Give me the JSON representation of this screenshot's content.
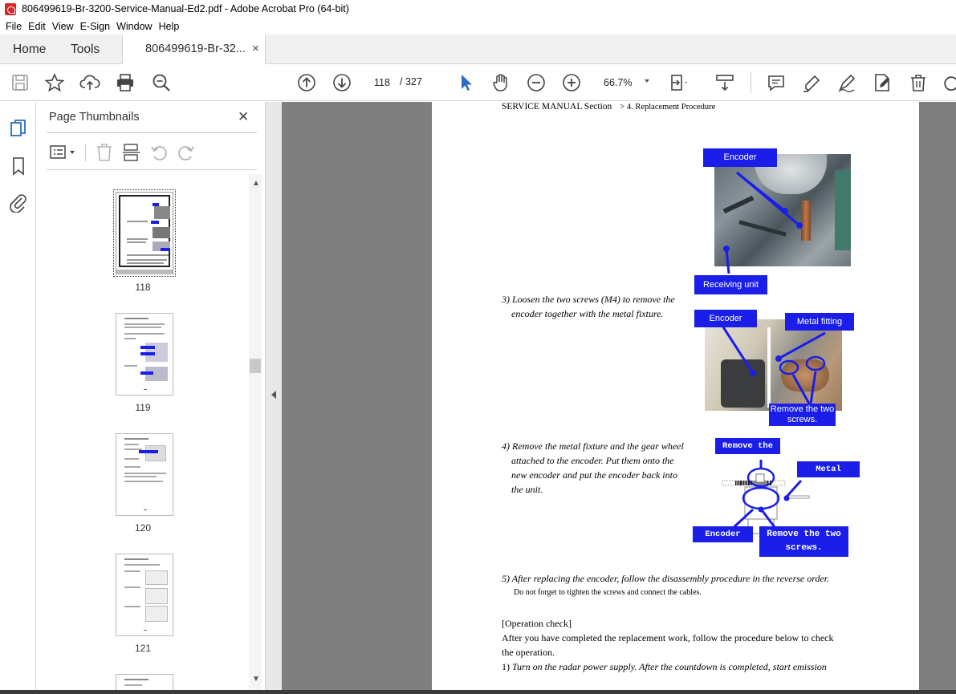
{
  "window": {
    "title": "806499619-Br-3200-Service-Manual-Ed2.pdf - Adobe Acrobat Pro (64-bit)"
  },
  "menu": [
    "File",
    "Edit",
    "View",
    "E-Sign",
    "Window",
    "Help"
  ],
  "tabs": {
    "home": "Home",
    "tools": "Tools",
    "document": "806499619-Br-32...",
    "close": "×"
  },
  "toolbar": {
    "page_current": "118",
    "page_total": "/ 327",
    "zoom": "66.7%",
    "icons": [
      "save-icon",
      "bookmark-star-icon",
      "upload-icon",
      "print-icon",
      "search-zoom-icon",
      "page-up-icon",
      "page-down-icon",
      "select-cursor-icon",
      "hand-icon",
      "zoom-out-icon",
      "zoom-in-icon",
      "fit-page-icon",
      "scroll-mode-icon",
      "comment-icon",
      "highlight-pen-icon",
      "sign-icon",
      "edit-icon",
      "delete-icon",
      "rotate-icon"
    ]
  },
  "thumbnails_panel": {
    "title": "Page Thumbnails",
    "close": "✕",
    "pages": [
      "118",
      "119",
      "120",
      "121"
    ]
  },
  "document": {
    "header": "SERVICE MANUAL Section",
    "header_sub": "> 4. Replacement Procedure",
    "labels": {
      "encoder1": "Encoder",
      "receiving_unit": "Receiving unit",
      "encoder2": "Encoder",
      "metal_fitting": "Metal fitting",
      "remove_two_screws_a": "Remove the two",
      "remove_two_screws_b": "screws.",
      "remove_nut": "Remove the nut",
      "metal_fitting2": "Metal fitting",
      "encoder3": "Encoder",
      "remove_two_screws2_a": "Remove the two",
      "remove_two_screws2_b": "screws."
    },
    "step3": {
      "line1": "3) Loosen the two screws (M4) to remove the",
      "line2": "encoder together with the metal fixture."
    },
    "step4": {
      "line1": "4) Remove the metal fixture and the gear wheel",
      "line2": "attached to the encoder. Put them onto the",
      "line3": "new encoder and put the encoder back into",
      "line4": "the unit."
    },
    "step5": {
      "line1": "5) After replacing the encoder, follow the disassembly procedure in the reverse order.",
      "line2": "Do not forget to tighten the screws and connect the cables."
    },
    "op_check": {
      "heading": "[Operation check]",
      "line1": "After you have completed the replacement work, follow the procedure below to check",
      "line2": "the operation.",
      "line3_num": "1) ",
      "line3": "Turn on the radar power supply. After the countdown is completed, start emission"
    }
  },
  "colors": {
    "label_blue": "#1a1ee8",
    "doc_bg": "#7f7f7f",
    "accent_blue": "#2b6cc4"
  }
}
